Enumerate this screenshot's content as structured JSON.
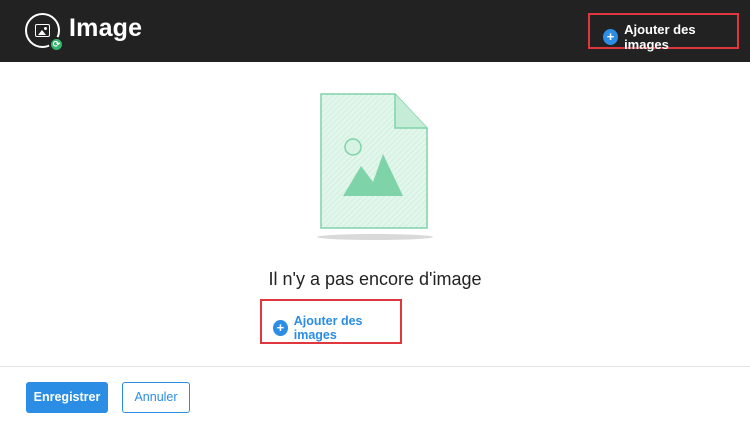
{
  "header": {
    "title": "Image",
    "add_label": "Ajouter des images",
    "logo_icon": "image-icon",
    "badge_icon": "sync-badge-icon"
  },
  "empty_state": {
    "message": "Il n'y a pas encore d'image",
    "add_label": "Ajouter des images",
    "illustration_icon": "image-file-icon"
  },
  "footer": {
    "save_label": "Enregistrer",
    "cancel_label": "Annuler"
  },
  "colors": {
    "header_bg": "#222222",
    "accent": "#2b8de3",
    "highlight": "#e0363d",
    "illustration": "#7fd3a8"
  }
}
